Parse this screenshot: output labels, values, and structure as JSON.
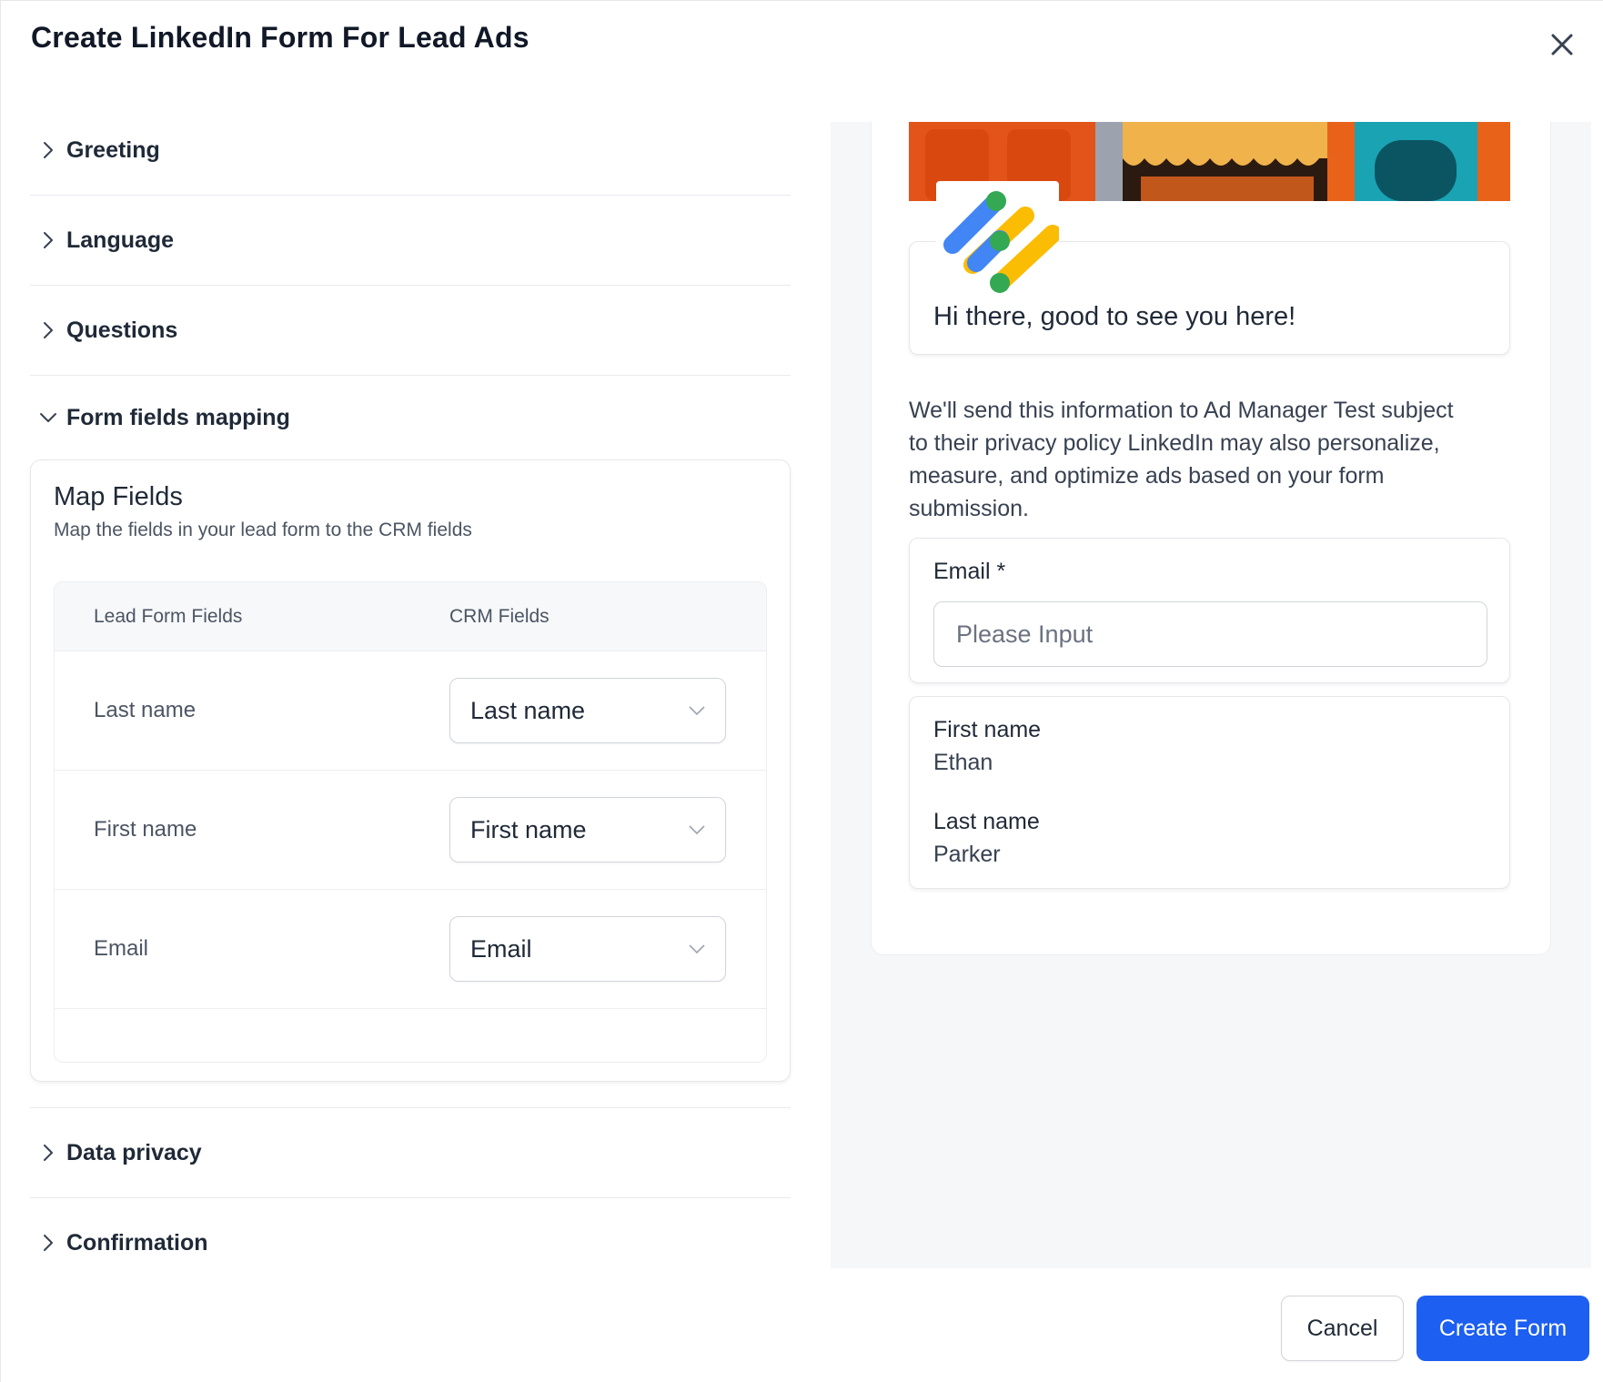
{
  "dialog": {
    "title": "Create LinkedIn Form For Lead Ads"
  },
  "accordion": {
    "sections": [
      {
        "label": "Greeting",
        "open": false
      },
      {
        "label": "Language",
        "open": false
      },
      {
        "label": "Questions",
        "open": false
      },
      {
        "label": "Form fields mapping",
        "open": true
      },
      {
        "label": "Data privacy",
        "open": false
      },
      {
        "label": "Confirmation",
        "open": false
      }
    ]
  },
  "map_fields": {
    "title": "Map Fields",
    "subtitle": "Map the fields in your lead form to the CRM fields",
    "headers": [
      "Lead Form Fields",
      "CRM Fields"
    ],
    "rows": [
      {
        "lead": "Last name",
        "crm": "Last name"
      },
      {
        "lead": "First name",
        "crm": "First name"
      },
      {
        "lead": "Email",
        "crm": "Email"
      }
    ]
  },
  "preview": {
    "greeting": "Hi there, good to see you here!",
    "privacy_lines": [
      "We'll send this information to Ad Manager Test subject",
      "to their privacy policy LinkedIn may also personalize,",
      "measure, and optimize ads based on your form",
      "submission."
    ],
    "email_label": "Email *",
    "email_placeholder": "Please Input",
    "first_name_label": "First name",
    "first_name_value": "Ethan",
    "last_name_label": "Last name",
    "last_name_value": "Parker"
  },
  "footer": {
    "cancel_label": "Cancel",
    "create_label": "Create Form"
  },
  "colors": {
    "primary": "#1d5ff0",
    "logo_blue": "#4285f4",
    "logo_yellow": "#fbbc04",
    "logo_green": "#34a853"
  }
}
